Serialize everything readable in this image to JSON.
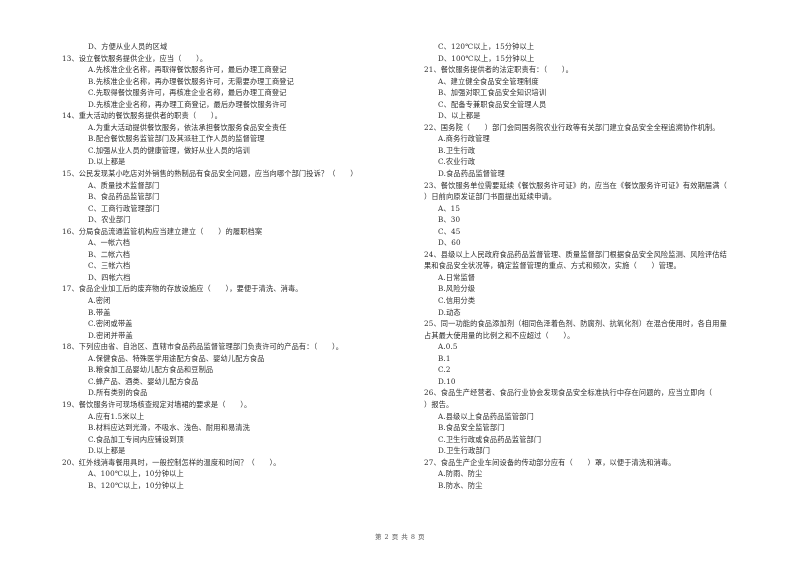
{
  "left_column": {
    "carryover": [
      "D、方便从业人员的区域"
    ],
    "questions": [
      {
        "stem": "13、设立餐饮服务提供企业，应当（　　）。",
        "options": [
          "A.先核准企业名称，再取得餐饮服务许可，最后办理工商登记",
          "B.先核准企业名称，再办理餐饮服务许可，无需要办理工商登记",
          "C.先取得餐饮服务许可，再核准企业名称，最后办理工商登记",
          "D.先核准企业名称，再办理工商登记，最后办理餐饮服务许可"
        ]
      },
      {
        "stem": "14、重大活动的餐饮服务提供者的职责（　　）。",
        "options": [
          "A.为重大活动提供餐饮服务，依法承担餐饮服务食品安全责任",
          "B.配合餐饮服务监管部门及其派驻工作人员的监督管理",
          "C.加强从业人员的健康管理，做好从业人员的培训",
          "D.以上都是"
        ]
      },
      {
        "stem": "15、公民发现某小吃店对外销售的熟制品有食品安全问题，应当向哪个部门投诉？（　　）",
        "options": [
          "A、质量技术监督部门",
          "B、食品药品监管部门",
          "C、工商行政管理部门",
          "D、农业部门"
        ]
      },
      {
        "stem": "16、分局食品流通监管机构应当建立建立（　　）的履职档案",
        "options": [
          "A、一帐六档",
          "B、二帐六档",
          "C、三帐六档",
          "D、四帐六档"
        ]
      },
      {
        "stem": "17、食品企业加工后的废弃物的存放设施应（　　），要便于清洗、消毒。",
        "options": [
          "A.密闭",
          "B.带盖",
          "C.密闭或带盖",
          "D.密闭并带盖"
        ]
      },
      {
        "stem": "18、下列应由省、自治区、直辖市食品药品监督管理部门负责许可的产品有：（　　）。",
        "options": [
          "A.保健食品、特殊医学用途配方食品、婴幼儿配方食品",
          "B.粮食加工品婴幼儿配方食品和豆制品",
          "C.蜂产品、酒类、婴幼儿配方食品",
          "D.所有类别的食品"
        ]
      },
      {
        "stem": "19、餐饮服务许可现场核查规定对墙裙的要求是（　　）。",
        "options": [
          "A.应有1.5米以上",
          "B.材料应达到光滑，不吸水、浅色、耐用和易清洗",
          "C.食品加工专间内应铺设到顶",
          "D.以上都是"
        ]
      },
      {
        "stem": "20、红外线消毒餐用具时，一般控制怎样的温度和时间？（　　）。",
        "options": [
          "A、100℃以上，10分钟以上",
          "B、120℃以上，10分钟以上"
        ]
      }
    ]
  },
  "right_column": {
    "carryover": [
      "C、120℃以上，15分钟以上",
      "D、100℃以上，15分钟以上"
    ],
    "questions": [
      {
        "stem": "21、餐饮服务提供者的法定职责有：（　　）。",
        "options": [
          "A、建立健全食品安全管理制度",
          "B、加强对职工食品安全知识培训",
          "C、配备专兼职食品安全管理人员",
          "D、以上都是"
        ]
      },
      {
        "stem": "22、国务院（　　）部门会同国务院农业行政等有关部门建立食品安全全程追溯协作机制。",
        "options": [
          "A.商务行政管理",
          "B.卫生行政",
          "C.农业行政",
          "D.食品药品监督管理"
        ]
      },
      {
        "stem_lines": [
          "23、餐饮服务单位需要延续《餐饮服务许可证》的，应当在《餐饮服务许可证》有效期届满（",
          "）日前向原发证部门书面提出延续申请。"
        ],
        "options": [
          "A、15",
          "B、30",
          "C、45",
          "D、60"
        ]
      },
      {
        "stem_lines": [
          "24、县级以上人民政府食品药品监督管理、质量监督部门根据食品安全风险监测、风险评估结",
          "果和食品安全状况等，确定监督管理的重点、方式和频次，实施（　　）管理。"
        ],
        "options": [
          "A.日常监督",
          "B.风险分级",
          "C.信用分类",
          "D.动态"
        ]
      },
      {
        "stem_lines": [
          "25、同一功能的食品添加剂（相同色泽着色剂、防腐剂、抗氧化剂）在混合使用时，各自用量",
          "占其最大使用量的比例之和不应超过（　　）。"
        ],
        "options": [
          "A.0.5",
          "B.1",
          "C.2",
          "D.10"
        ]
      },
      {
        "stem_lines": [
          "26、食品生产经营者、食品行业协会发现食品安全标准执行中存在问题的，应当立即向（",
          "）报告。"
        ],
        "options": [
          "A.县级以上食品药品监管部门",
          "B.食品安全监管部门",
          "C.卫生行政或食品药品监管部门",
          "D.卫生行政部门"
        ]
      },
      {
        "stem": "27、食品生产企业车间设备的传动部分应有（　　）罩，以便于清洗和消毒。",
        "options": [
          "A.防雨、防尘",
          "B.防水、防尘"
        ]
      }
    ]
  },
  "footer": {
    "page_label": "第 2 页 共 8 页"
  }
}
